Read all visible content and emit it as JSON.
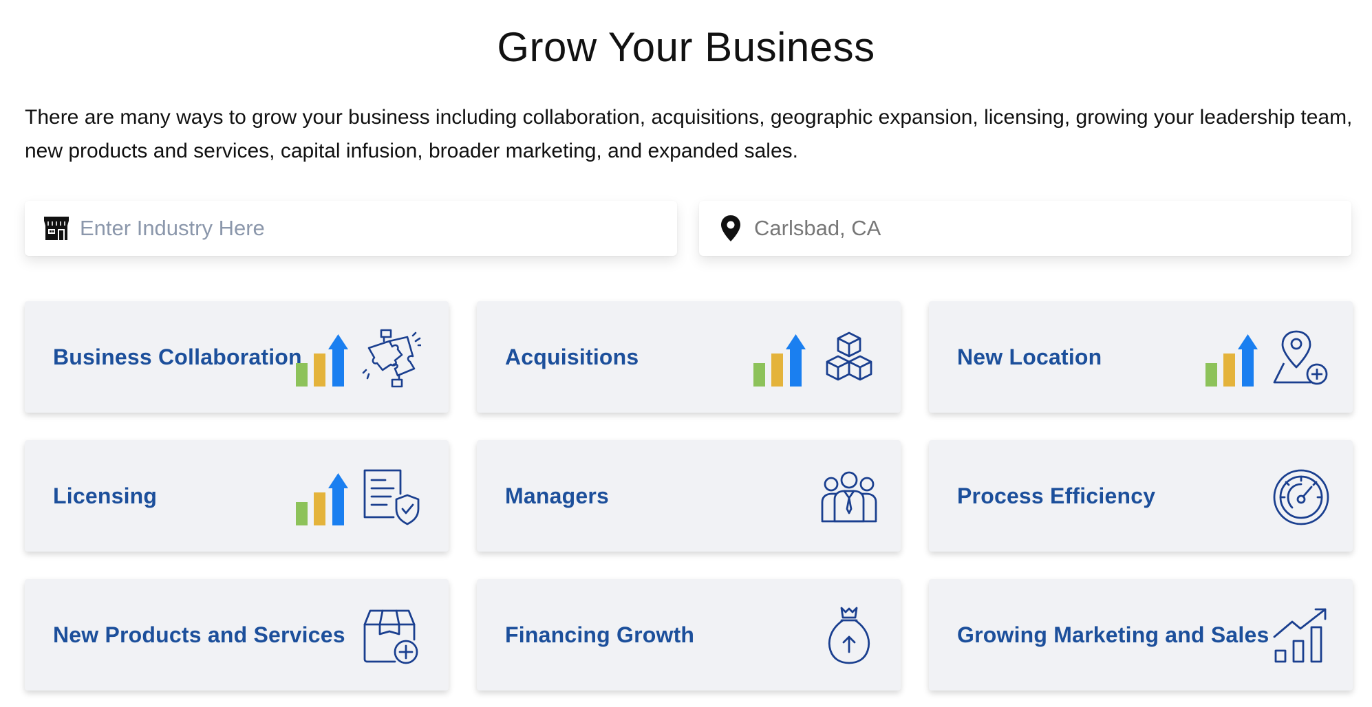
{
  "header": {
    "title": "Grow Your Business",
    "intro": "There are many ways to grow your business including collaboration, acquisitions, geographic expansion, licensing, growing your leadership team, new products and services, capital infusion, broader marketing, and expanded sales."
  },
  "search": {
    "industry": {
      "placeholder": "Enter Industry Here",
      "value": "",
      "icon": "storefront-icon"
    },
    "location": {
      "placeholder": "Carlsbad, CA",
      "value": "",
      "icon": "map-pin-icon"
    }
  },
  "cards": [
    {
      "label": "Business Collaboration",
      "icon": "puzzle-handshake-icon",
      "growth_badge": true
    },
    {
      "label": "Acquisitions",
      "icon": "stacked-boxes-icon",
      "growth_badge": true
    },
    {
      "label": "New Location",
      "icon": "location-add-icon",
      "growth_badge": true
    },
    {
      "label": "Licensing",
      "icon": "shield-document-icon",
      "growth_badge": true
    },
    {
      "label": "Managers",
      "icon": "team-icon",
      "growth_badge": false
    },
    {
      "label": "Process Efficiency",
      "icon": "speedometer-icon",
      "growth_badge": false
    },
    {
      "label": "New Products and Services",
      "icon": "package-add-icon",
      "growth_badge": false
    },
    {
      "label": "Financing Growth",
      "icon": "money-bag-icon",
      "growth_badge": false
    },
    {
      "label": "Growing Marketing and Sales",
      "icon": "growth-chart-icon",
      "growth_badge": false
    }
  ],
  "colors": {
    "accent": "#1c4f9b",
    "icon_stroke": "#1a3f8f",
    "card_bg": "#f1f2f5",
    "bar_green": "#8dc25a",
    "bar_yellow": "#e4b33b",
    "arrow_blue": "#1a7ff0"
  }
}
